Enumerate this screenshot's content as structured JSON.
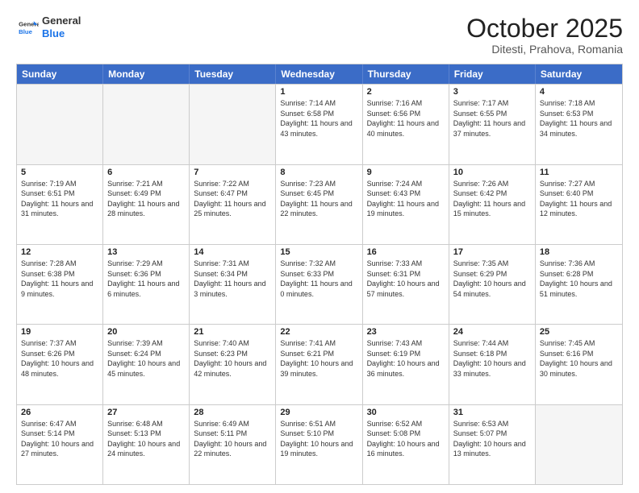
{
  "header": {
    "logo_line1": "General",
    "logo_line2": "Blue",
    "month": "October 2025",
    "location": "Ditesti, Prahova, Romania"
  },
  "days_of_week": [
    "Sunday",
    "Monday",
    "Tuesday",
    "Wednesday",
    "Thursday",
    "Friday",
    "Saturday"
  ],
  "weeks": [
    [
      {
        "day": "",
        "sunrise": "",
        "sunset": "",
        "daylight": "",
        "shaded": true
      },
      {
        "day": "",
        "sunrise": "",
        "sunset": "",
        "daylight": "",
        "shaded": true
      },
      {
        "day": "",
        "sunrise": "",
        "sunset": "",
        "daylight": "",
        "shaded": true
      },
      {
        "day": "1",
        "sunrise": "Sunrise: 7:14 AM",
        "sunset": "Sunset: 6:58 PM",
        "daylight": "Daylight: 11 hours and 43 minutes.",
        "shaded": false
      },
      {
        "day": "2",
        "sunrise": "Sunrise: 7:16 AM",
        "sunset": "Sunset: 6:56 PM",
        "daylight": "Daylight: 11 hours and 40 minutes.",
        "shaded": false
      },
      {
        "day": "3",
        "sunrise": "Sunrise: 7:17 AM",
        "sunset": "Sunset: 6:55 PM",
        "daylight": "Daylight: 11 hours and 37 minutes.",
        "shaded": false
      },
      {
        "day": "4",
        "sunrise": "Sunrise: 7:18 AM",
        "sunset": "Sunset: 6:53 PM",
        "daylight": "Daylight: 11 hours and 34 minutes.",
        "shaded": false
      }
    ],
    [
      {
        "day": "5",
        "sunrise": "Sunrise: 7:19 AM",
        "sunset": "Sunset: 6:51 PM",
        "daylight": "Daylight: 11 hours and 31 minutes.",
        "shaded": false
      },
      {
        "day": "6",
        "sunrise": "Sunrise: 7:21 AM",
        "sunset": "Sunset: 6:49 PM",
        "daylight": "Daylight: 11 hours and 28 minutes.",
        "shaded": false
      },
      {
        "day": "7",
        "sunrise": "Sunrise: 7:22 AM",
        "sunset": "Sunset: 6:47 PM",
        "daylight": "Daylight: 11 hours and 25 minutes.",
        "shaded": false
      },
      {
        "day": "8",
        "sunrise": "Sunrise: 7:23 AM",
        "sunset": "Sunset: 6:45 PM",
        "daylight": "Daylight: 11 hours and 22 minutes.",
        "shaded": false
      },
      {
        "day": "9",
        "sunrise": "Sunrise: 7:24 AM",
        "sunset": "Sunset: 6:43 PM",
        "daylight": "Daylight: 11 hours and 19 minutes.",
        "shaded": false
      },
      {
        "day": "10",
        "sunrise": "Sunrise: 7:26 AM",
        "sunset": "Sunset: 6:42 PM",
        "daylight": "Daylight: 11 hours and 15 minutes.",
        "shaded": false
      },
      {
        "day": "11",
        "sunrise": "Sunrise: 7:27 AM",
        "sunset": "Sunset: 6:40 PM",
        "daylight": "Daylight: 11 hours and 12 minutes.",
        "shaded": false
      }
    ],
    [
      {
        "day": "12",
        "sunrise": "Sunrise: 7:28 AM",
        "sunset": "Sunset: 6:38 PM",
        "daylight": "Daylight: 11 hours and 9 minutes.",
        "shaded": false
      },
      {
        "day": "13",
        "sunrise": "Sunrise: 7:29 AM",
        "sunset": "Sunset: 6:36 PM",
        "daylight": "Daylight: 11 hours and 6 minutes.",
        "shaded": false
      },
      {
        "day": "14",
        "sunrise": "Sunrise: 7:31 AM",
        "sunset": "Sunset: 6:34 PM",
        "daylight": "Daylight: 11 hours and 3 minutes.",
        "shaded": false
      },
      {
        "day": "15",
        "sunrise": "Sunrise: 7:32 AM",
        "sunset": "Sunset: 6:33 PM",
        "daylight": "Daylight: 11 hours and 0 minutes.",
        "shaded": false
      },
      {
        "day": "16",
        "sunrise": "Sunrise: 7:33 AM",
        "sunset": "Sunset: 6:31 PM",
        "daylight": "Daylight: 10 hours and 57 minutes.",
        "shaded": false
      },
      {
        "day": "17",
        "sunrise": "Sunrise: 7:35 AM",
        "sunset": "Sunset: 6:29 PM",
        "daylight": "Daylight: 10 hours and 54 minutes.",
        "shaded": false
      },
      {
        "day": "18",
        "sunrise": "Sunrise: 7:36 AM",
        "sunset": "Sunset: 6:28 PM",
        "daylight": "Daylight: 10 hours and 51 minutes.",
        "shaded": false
      }
    ],
    [
      {
        "day": "19",
        "sunrise": "Sunrise: 7:37 AM",
        "sunset": "Sunset: 6:26 PM",
        "daylight": "Daylight: 10 hours and 48 minutes.",
        "shaded": false
      },
      {
        "day": "20",
        "sunrise": "Sunrise: 7:39 AM",
        "sunset": "Sunset: 6:24 PM",
        "daylight": "Daylight: 10 hours and 45 minutes.",
        "shaded": false
      },
      {
        "day": "21",
        "sunrise": "Sunrise: 7:40 AM",
        "sunset": "Sunset: 6:23 PM",
        "daylight": "Daylight: 10 hours and 42 minutes.",
        "shaded": false
      },
      {
        "day": "22",
        "sunrise": "Sunrise: 7:41 AM",
        "sunset": "Sunset: 6:21 PM",
        "daylight": "Daylight: 10 hours and 39 minutes.",
        "shaded": false
      },
      {
        "day": "23",
        "sunrise": "Sunrise: 7:43 AM",
        "sunset": "Sunset: 6:19 PM",
        "daylight": "Daylight: 10 hours and 36 minutes.",
        "shaded": false
      },
      {
        "day": "24",
        "sunrise": "Sunrise: 7:44 AM",
        "sunset": "Sunset: 6:18 PM",
        "daylight": "Daylight: 10 hours and 33 minutes.",
        "shaded": false
      },
      {
        "day": "25",
        "sunrise": "Sunrise: 7:45 AM",
        "sunset": "Sunset: 6:16 PM",
        "daylight": "Daylight: 10 hours and 30 minutes.",
        "shaded": false
      }
    ],
    [
      {
        "day": "26",
        "sunrise": "Sunrise: 6:47 AM",
        "sunset": "Sunset: 5:14 PM",
        "daylight": "Daylight: 10 hours and 27 minutes.",
        "shaded": false
      },
      {
        "day": "27",
        "sunrise": "Sunrise: 6:48 AM",
        "sunset": "Sunset: 5:13 PM",
        "daylight": "Daylight: 10 hours and 24 minutes.",
        "shaded": false
      },
      {
        "day": "28",
        "sunrise": "Sunrise: 6:49 AM",
        "sunset": "Sunset: 5:11 PM",
        "daylight": "Daylight: 10 hours and 22 minutes.",
        "shaded": false
      },
      {
        "day": "29",
        "sunrise": "Sunrise: 6:51 AM",
        "sunset": "Sunset: 5:10 PM",
        "daylight": "Daylight: 10 hours and 19 minutes.",
        "shaded": false
      },
      {
        "day": "30",
        "sunrise": "Sunrise: 6:52 AM",
        "sunset": "Sunset: 5:08 PM",
        "daylight": "Daylight: 10 hours and 16 minutes.",
        "shaded": false
      },
      {
        "day": "31",
        "sunrise": "Sunrise: 6:53 AM",
        "sunset": "Sunset: 5:07 PM",
        "daylight": "Daylight: 10 hours and 13 minutes.",
        "shaded": false
      },
      {
        "day": "",
        "sunrise": "",
        "sunset": "",
        "daylight": "",
        "shaded": true
      }
    ]
  ]
}
